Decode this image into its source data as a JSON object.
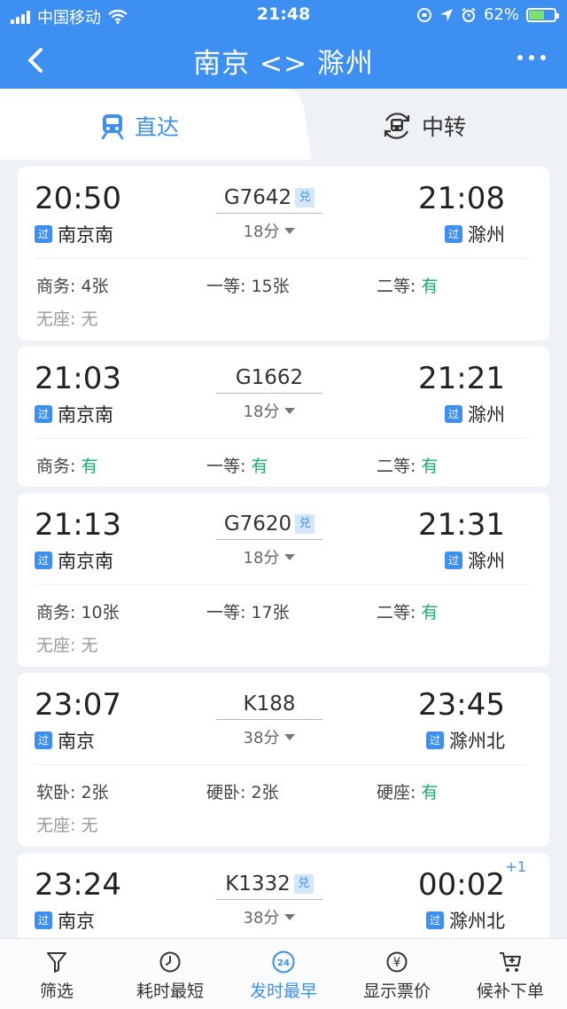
{
  "status_bar": {
    "carrier": "中国移动",
    "time": "21:48",
    "battery": "62%",
    "battery_level": 0.62
  },
  "nav": {
    "title": "南京 <> 滁州"
  },
  "tabs": [
    {
      "label": "直达",
      "active": true
    },
    {
      "label": "中转",
      "active": false
    }
  ],
  "badge_pass": "过",
  "badge_exchange": "兑",
  "trains": [
    {
      "dep_time": "20:50",
      "dep_station": "南京南",
      "train_no": "G7642",
      "exchange": true,
      "duration": "18分",
      "arr_time": "21:08",
      "arr_station": "滁州",
      "seats": [
        {
          "label": "商务: ",
          "value": "4张"
        },
        {
          "label": "一等: ",
          "value": "15张"
        },
        {
          "label": "二等: ",
          "value": "有"
        }
      ],
      "standing": {
        "label": "无座: ",
        "value": "无"
      }
    },
    {
      "dep_time": "21:03",
      "dep_station": "南京南",
      "train_no": "G1662",
      "exchange": false,
      "duration": "18分",
      "arr_time": "21:21",
      "arr_station": "滁州",
      "seats": [
        {
          "label": "商务: ",
          "value": "有"
        },
        {
          "label": "一等: ",
          "value": "有"
        },
        {
          "label": "二等: ",
          "value": "有"
        }
      ]
    },
    {
      "dep_time": "21:13",
      "dep_station": "南京南",
      "train_no": "G7620",
      "exchange": true,
      "duration": "18分",
      "arr_time": "21:31",
      "arr_station": "滁州",
      "seats": [
        {
          "label": "商务: ",
          "value": "10张"
        },
        {
          "label": "一等: ",
          "value": "17张"
        },
        {
          "label": "二等: ",
          "value": "有"
        }
      ],
      "standing": {
        "label": "无座: ",
        "value": "无"
      }
    },
    {
      "dep_time": "23:07",
      "dep_station": "南京",
      "train_no": "K188",
      "exchange": false,
      "duration": "38分",
      "arr_time": "23:45",
      "arr_station": "滁州北",
      "seats": [
        {
          "label": "软卧: ",
          "value": "2张"
        },
        {
          "label": "硬卧: ",
          "value": "2张"
        },
        {
          "label": "硬座: ",
          "value": "有"
        }
      ],
      "standing": {
        "label": "无座: ",
        "value": "无"
      }
    },
    {
      "dep_time": "23:24",
      "dep_station": "南京",
      "train_no": "K1332",
      "exchange": true,
      "duration": "38分",
      "arr_time": "00:02",
      "arr_station": "滁州北",
      "next_day": "+1"
    }
  ],
  "bottom_bar": [
    {
      "label": "筛选",
      "icon": "filter-icon"
    },
    {
      "label": "耗时最短",
      "icon": "timer-icon"
    },
    {
      "label": "发时最早",
      "icon": "clock-24-icon",
      "active": true,
      "icon_text": "24"
    },
    {
      "label": "显示票价",
      "icon": "yen-icon",
      "icon_text": "¥"
    },
    {
      "label": "候补下单",
      "icon": "cart-plus-icon"
    }
  ],
  "colors": {
    "primary": "#3d8ff2",
    "available": "#1aad6f",
    "background": "#eef1f5"
  }
}
